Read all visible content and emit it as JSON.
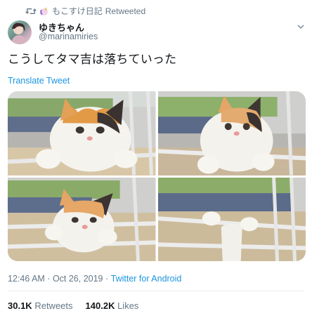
{
  "retweet_banner": {
    "user": "もこすけ日記",
    "label": "Retweeted",
    "icon": "retweet-icon"
  },
  "author": {
    "display_name": "ゆきちゃん",
    "handle": "@marinamiries"
  },
  "tweet": {
    "text": "こうしてタマ吉は落ちていった",
    "translate_label": "Translate Tweet"
  },
  "media": {
    "photo_count": 4
  },
  "meta": {
    "time": "12:46 AM",
    "separator": " · ",
    "date": "Oct 26, 2019",
    "source": "Twitter for Android"
  },
  "stats": {
    "retweets_count": "30.1K",
    "retweets_label": "Retweets",
    "likes_count": "140.2K",
    "likes_label": "Likes"
  },
  "colors": {
    "link": "#1b95e0",
    "muted": "#657786",
    "text": "#14171a"
  }
}
